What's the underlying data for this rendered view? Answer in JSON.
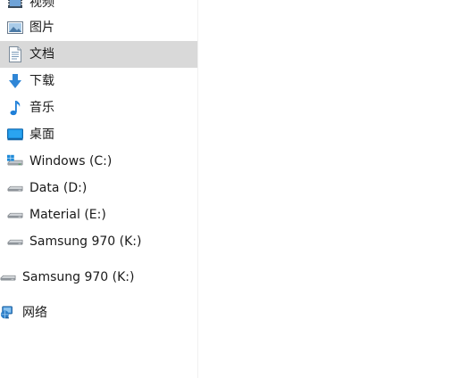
{
  "nav": {
    "quick_access": [
      {
        "label": "视频",
        "icon": "video-icon"
      },
      {
        "label": "图片",
        "icon": "pictures-icon"
      },
      {
        "label": "文档",
        "icon": "document-icon",
        "selected": true
      },
      {
        "label": "下载",
        "icon": "download-icon"
      },
      {
        "label": "音乐",
        "icon": "music-icon"
      },
      {
        "label": "桌面",
        "icon": "desktop-icon"
      },
      {
        "label": "Windows (C:)",
        "icon": "system-drive-icon"
      },
      {
        "label": "Data (D:)",
        "icon": "drive-icon"
      },
      {
        "label": "Material (E:)",
        "icon": "drive-icon"
      },
      {
        "label": "Samsung 970 (K:)",
        "icon": "drive-icon"
      }
    ],
    "external_drive": {
      "label": "Samsung 970 (K:)",
      "icon": "drive-icon"
    },
    "network": {
      "label": "网络",
      "icon": "network-icon"
    }
  },
  "colors": {
    "selected_bg": "#d9d9d9",
    "accent": "#1e7fd8"
  }
}
